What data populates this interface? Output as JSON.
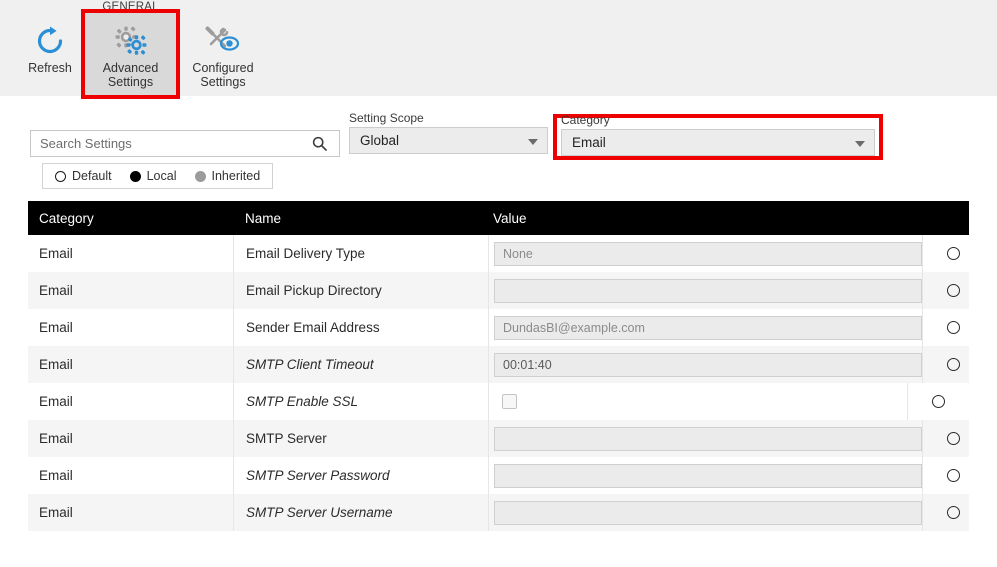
{
  "ribbon": {
    "group_label": "GENERAL",
    "buttons": [
      {
        "id": "refresh",
        "label_line1": "Refresh",
        "label_line2": "",
        "icon": "refresh-icon"
      },
      {
        "id": "advanced",
        "label_line1": "Advanced",
        "label_line2": "Settings",
        "icon": "gears-icon"
      },
      {
        "id": "configured",
        "label_line1": "Configured",
        "label_line2": "Settings",
        "icon": "tools-eye-icon"
      }
    ]
  },
  "filters": {
    "search": {
      "value": "",
      "placeholder": "Search Settings",
      "icon": "search-icon"
    },
    "legend": [
      {
        "label": "Default",
        "marker": "hollow"
      },
      {
        "label": "Local",
        "marker": "solid"
      },
      {
        "label": "Inherited",
        "marker": "gray"
      }
    ],
    "setting_scope": {
      "label": "Setting Scope",
      "value": "Global"
    },
    "category": {
      "label": "Category",
      "value": "Email"
    }
  },
  "table": {
    "columns": [
      "Category",
      "Name",
      "Value"
    ],
    "rows": [
      {
        "category": "Email",
        "name": "Email Delivery Type",
        "italic": false,
        "control": "text",
        "value": "None",
        "dark": false,
        "indicator": "hollow"
      },
      {
        "category": "Email",
        "name": "Email Pickup Directory",
        "italic": false,
        "control": "text",
        "value": "",
        "dark": false,
        "indicator": "hollow"
      },
      {
        "category": "Email",
        "name": "Sender Email Address",
        "italic": false,
        "control": "text",
        "value": "DundasBI@example.com",
        "dark": false,
        "indicator": "hollow"
      },
      {
        "category": "Email",
        "name": "SMTP Client Timeout",
        "italic": true,
        "control": "text",
        "value": "00:01:40",
        "dark": true,
        "indicator": "hollow"
      },
      {
        "category": "Email",
        "name": "SMTP Enable SSL",
        "italic": true,
        "control": "checkbox",
        "value": "",
        "dark": false,
        "indicator": "hollow",
        "checked": false
      },
      {
        "category": "Email",
        "name": "SMTP Server",
        "italic": false,
        "control": "text",
        "value": "",
        "dark": false,
        "indicator": "hollow"
      },
      {
        "category": "Email",
        "name": "SMTP Server Password",
        "italic": true,
        "control": "text",
        "value": "",
        "dark": false,
        "indicator": "hollow"
      },
      {
        "category": "Email",
        "name": "SMTP Server Username",
        "italic": true,
        "control": "text",
        "value": "",
        "dark": false,
        "indicator": "hollow"
      }
    ]
  },
  "annotations": {
    "highlight_color": "#ee0000",
    "boxes": [
      "advanced-settings-button",
      "category-dropdown"
    ]
  }
}
